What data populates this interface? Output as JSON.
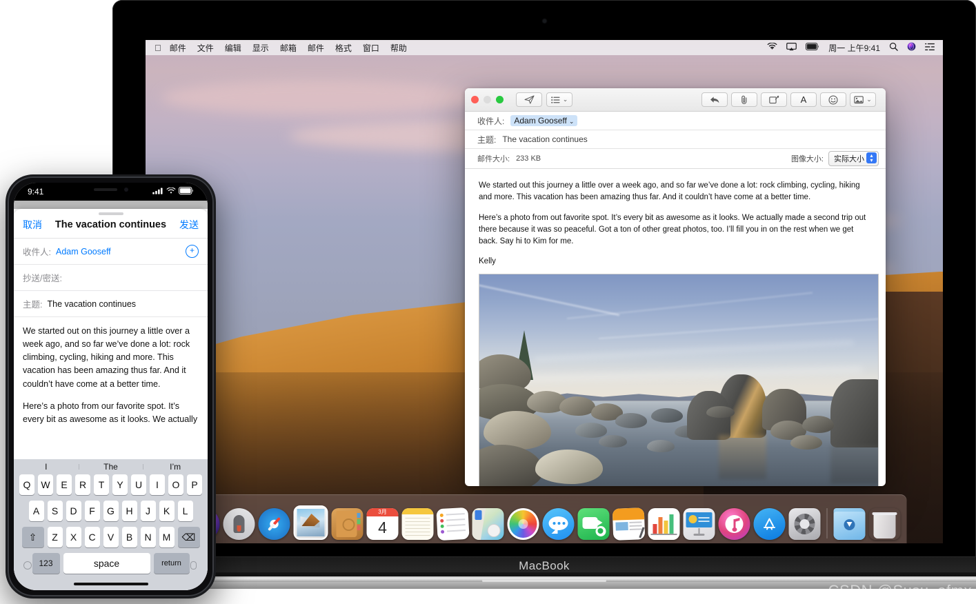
{
  "menubar": {
    "apple_icon": "apple-logo-icon",
    "items": [
      "邮件",
      "文件",
      "编辑",
      "显示",
      "邮箱",
      "邮件",
      "格式",
      "窗口",
      "帮助"
    ],
    "status_icons": [
      "wifi-icon",
      "airplay-icon",
      "battery-icon"
    ],
    "clock": "周一 上午9:41",
    "right_icons": [
      "search-icon",
      "siri-icon",
      "control-center-icon"
    ]
  },
  "mail_window": {
    "toolbar": {
      "send_icon": "send-paperplane-icon",
      "headerfields_icon": "header-fields-icon",
      "chevron": "⌄",
      "right_buttons": [
        {
          "name": "reply-icon",
          "glyph": "↰"
        },
        {
          "name": "attach-paperclip-icon",
          "glyph": "📎"
        },
        {
          "name": "markup-icon",
          "glyph": "✎"
        },
        {
          "name": "format-text-icon",
          "glyph": "A"
        },
        {
          "name": "emoji-icon",
          "glyph": "☺"
        },
        {
          "name": "photo-browser-icon",
          "glyph": "🖼"
        }
      ]
    },
    "to_label": "收件人:",
    "to_value": "Adam Gooseff",
    "to_chevron": "⌄",
    "subject_label": "主题:",
    "subject_value": "The vacation continues",
    "size_label": "邮件大小:",
    "size_value": "233 KB",
    "image_size_label": "图像大小:",
    "image_size_value": "实际大小",
    "body": {
      "p1": "We started out this journey a little over a week ago, and so far we’ve done a lot: rock climbing, cycling, hiking and more. This vacation has been amazing thus far. And it couldn’t have come at a better time.",
      "p2": "Here’s a photo from out favorite spot. It’s every bit as awesome as it looks. We actually made a second trip out there because it was so peaceful. Got a ton of other great photos, too. I’ll fill you in on the rest when we get back. Say hi to Kim for me.",
      "signature": "Kelly",
      "photo_alt": "lake-tahoe-rocks-photo"
    }
  },
  "dock": {
    "items": [
      {
        "name": "siri-icon",
        "label": "Siri"
      },
      {
        "name": "launchpad-icon",
        "label": "Launchpad"
      },
      {
        "name": "safari-icon",
        "label": "Safari"
      },
      {
        "name": "mail-icon",
        "label": "Mail",
        "running": true
      },
      {
        "name": "contacts-icon",
        "label": "Contacts"
      },
      {
        "name": "calendar-icon",
        "label": "Calendar",
        "month": "3月",
        "day": "4"
      },
      {
        "name": "notes-icon",
        "label": "Notes"
      },
      {
        "name": "reminders-icon",
        "label": "Reminders"
      },
      {
        "name": "maps-icon",
        "label": "Maps"
      },
      {
        "name": "photos-icon",
        "label": "Photos"
      },
      {
        "name": "messages-icon",
        "label": "Messages"
      },
      {
        "name": "facetime-icon",
        "label": "FaceTime"
      },
      {
        "name": "pages-icon",
        "label": "Pages"
      },
      {
        "name": "numbers-icon",
        "label": "Numbers"
      },
      {
        "name": "keynote-icon",
        "label": "Keynote"
      },
      {
        "name": "itunes-icon",
        "label": "iTunes"
      },
      {
        "name": "app-store-icon",
        "label": "App Store"
      },
      {
        "name": "system-preferences-icon",
        "label": "System Preferences"
      },
      {
        "name": "downloads-folder-icon",
        "label": "Downloads"
      },
      {
        "name": "trash-icon",
        "label": "Trash"
      }
    ]
  },
  "macbook": {
    "label": "MacBook"
  },
  "iphone": {
    "status": {
      "time": "9:41",
      "cellular_icon": "cellular-bars-icon",
      "wifi_icon": "wifi-icon",
      "battery_icon": "battery-icon"
    },
    "navbar": {
      "cancel": "取消",
      "title": "The vacation continues",
      "send": "发送"
    },
    "to_label": "收件人:",
    "to_value": "Adam Gooseff",
    "add_icon": "add-contact-icon",
    "cc_bcc_label": "抄送/密送:",
    "subject_label": "主题:",
    "subject_value": "The vacation continues",
    "body": {
      "p1": "We started out on this journey a little over a week ago, and so far we’ve done a lot: rock climbing, cycling, hiking and more. This vacation has been amazing thus far. And it couldn’t have come at a better time.",
      "p2": "Here’s a photo from our favorite spot. It’s every bit as awesome as it looks. We actually"
    },
    "keyboard": {
      "predictions": [
        "I",
        "The",
        "I’m"
      ],
      "row1": [
        "Q",
        "W",
        "E",
        "R",
        "T",
        "Y",
        "U",
        "I",
        "O",
        "P"
      ],
      "row2": [
        "A",
        "S",
        "D",
        "F",
        "G",
        "H",
        "J",
        "K",
        "L"
      ],
      "row3": [
        "Z",
        "X",
        "C",
        "V",
        "B",
        "N",
        "M"
      ],
      "shift": "⇧",
      "delete": "⌫",
      "numbers": "123",
      "space": "space",
      "return": "return"
    }
  },
  "watermark": "CSDN @Susu_afmx",
  "colors": {
    "accent_blue": "#007aff",
    "token_blue": "#cde2f8",
    "dock_bg": "#6c564f",
    "green": "#28c940",
    "red": "#ff5f57"
  }
}
